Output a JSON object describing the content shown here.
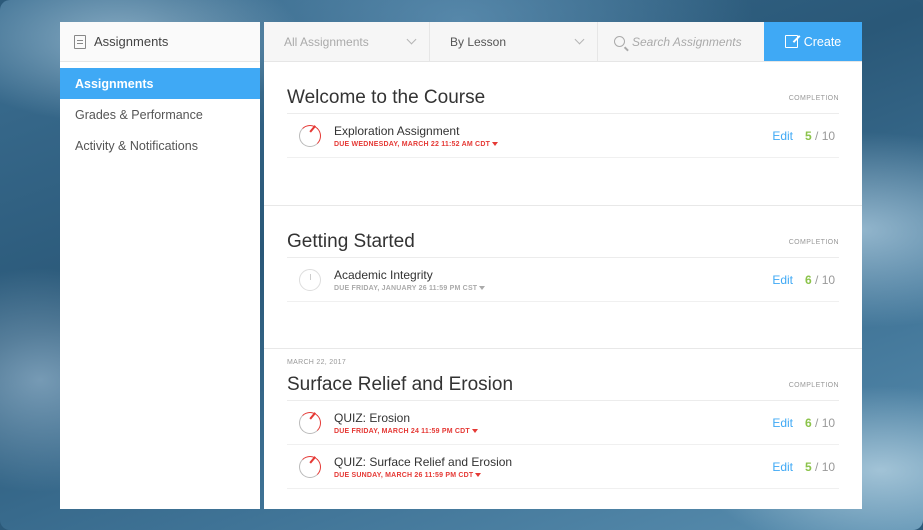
{
  "sidebar": {
    "header": "Assignments",
    "items": [
      {
        "label": "Assignments"
      },
      {
        "label": "Grades & Performance"
      },
      {
        "label": "Activity & Notifications"
      }
    ]
  },
  "toolbar": {
    "filter": "All Assignments",
    "group": "By Lesson",
    "search_placeholder": "Search Assignments",
    "create_label": "Create"
  },
  "completion_label": "COMPLETION",
  "edit_label": "Edit",
  "sections": [
    {
      "date": "",
      "title": "Welcome to the Course",
      "rows": [
        {
          "title": "Exploration Assignment",
          "due": "DUE WEDNESDAY, MARCH 22 11:52 AM CDT",
          "done": "5",
          "total": " / 10"
        }
      ]
    },
    {
      "date": "",
      "title": "Getting Started",
      "rows": [
        {
          "title": "Academic Integrity",
          "due": "DUE FRIDAY, JANUARY 26 11:59 PM CST",
          "done": "6",
          "total": " / 10"
        }
      ]
    },
    {
      "date": "MARCH 22, 2017",
      "title": "Surface Relief and Erosion",
      "rows": [
        {
          "title": "QUIZ: Erosion",
          "due": "DUE FRIDAY, MARCH 24 11:59 PM CDT",
          "done": "6",
          "total": " / 10"
        },
        {
          "title": "QUIZ: Surface Relief and Erosion",
          "due": "DUE SUNDAY, MARCH 26 11:59 PM CDT",
          "done": "5",
          "total": " / 10"
        }
      ]
    }
  ],
  "colors": {
    "accent": "#3fa9f5",
    "due_red": "#e53935",
    "score_green": "#8bc34a"
  }
}
